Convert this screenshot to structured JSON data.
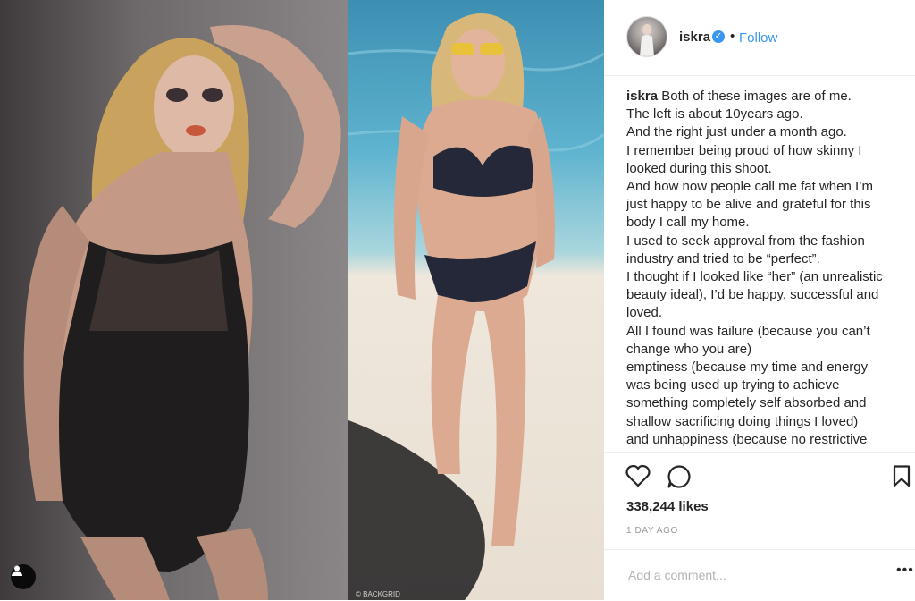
{
  "post": {
    "username": "iskra",
    "follow_label": "Follow",
    "separator": "•",
    "verified_icon": "verified-badge-icon",
    "caption_lines": [
      "Both of these images are of me.",
      "The left is about 10years ago.",
      "And the right just under a month ago.",
      "I remember being proud of how skinny I",
      "looked during this shoot.",
      "And how now people call me fat when I’m",
      "just happy to be alive and grateful for this",
      "body I call my home.",
      "I used to seek approval from the fashion",
      "industry and tried to be “perfect”.",
      "I thought if I looked like “her” (an unrealistic",
      "beauty ideal), I’d be happy, successful and",
      "loved.",
      "All I found was failure (because you can’t",
      "change who you are)",
      "emptiness (because my time and energy",
      "was being used up trying to achieve",
      "something completely self absorbed and",
      "shallow sacrificing doing things I loved)",
      "and unhappiness (because no restrictive"
    ],
    "likes": "338,244 likes",
    "time": "1 DAY AGO",
    "comment_placeholder": "Add a comment...",
    "more_label": "•••",
    "watermark": "© BACKGRID"
  },
  "icons": [
    "heart-icon",
    "comment-icon",
    "bookmark-icon",
    "user-tag-icon"
  ],
  "colors": {
    "accent": "#3897f0",
    "text": "#262626",
    "muted": "#999999",
    "border": "#efefef"
  }
}
